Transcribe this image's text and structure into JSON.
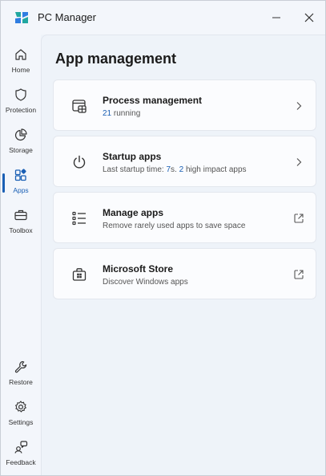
{
  "window": {
    "title": "PC Manager"
  },
  "sidebar": {
    "items": [
      {
        "label": "Home",
        "icon": "home-icon",
        "active": false
      },
      {
        "label": "Protection",
        "icon": "shield-icon",
        "active": false
      },
      {
        "label": "Storage",
        "icon": "pie-chart-icon",
        "active": false
      },
      {
        "label": "Apps",
        "icon": "apps-icon",
        "active": true
      },
      {
        "label": "Toolbox",
        "icon": "toolbox-icon",
        "active": false
      },
      {
        "label": "Restore",
        "icon": "wrench-icon",
        "active": false
      },
      {
        "label": "Settings",
        "icon": "gear-icon",
        "active": false
      },
      {
        "label": "Feedback",
        "icon": "feedback-icon",
        "active": false
      }
    ]
  },
  "main": {
    "title": "App management",
    "cards": [
      {
        "title": "Process management",
        "subtitle_parts": [
          {
            "text": "21",
            "highlight": true
          },
          {
            "text": " running",
            "highlight": false
          }
        ],
        "icon": "process-window-icon",
        "action_icon": "chevron-right-icon"
      },
      {
        "title": "Startup apps",
        "subtitle_parts": [
          {
            "text": "Last startup time: ",
            "highlight": false
          },
          {
            "text": "7",
            "highlight": true
          },
          {
            "text": "s. ",
            "highlight": false
          },
          {
            "text": "2",
            "highlight": true
          },
          {
            "text": " high impact apps",
            "highlight": false
          }
        ],
        "icon": "power-icon",
        "action_icon": "chevron-right-icon"
      },
      {
        "title": "Manage apps",
        "subtitle_parts": [
          {
            "text": "Remove rarely used apps to save space",
            "highlight": false
          }
        ],
        "icon": "list-icon",
        "action_icon": "external-link-icon"
      },
      {
        "title": "Microsoft Store",
        "subtitle_parts": [
          {
            "text": "Discover Windows apps",
            "highlight": false
          }
        ],
        "icon": "store-bag-icon",
        "action_icon": "external-link-icon"
      }
    ]
  },
  "colors": {
    "accent": "#1a5fb4",
    "background": "#eef3f9",
    "card": "#fbfcfe"
  }
}
